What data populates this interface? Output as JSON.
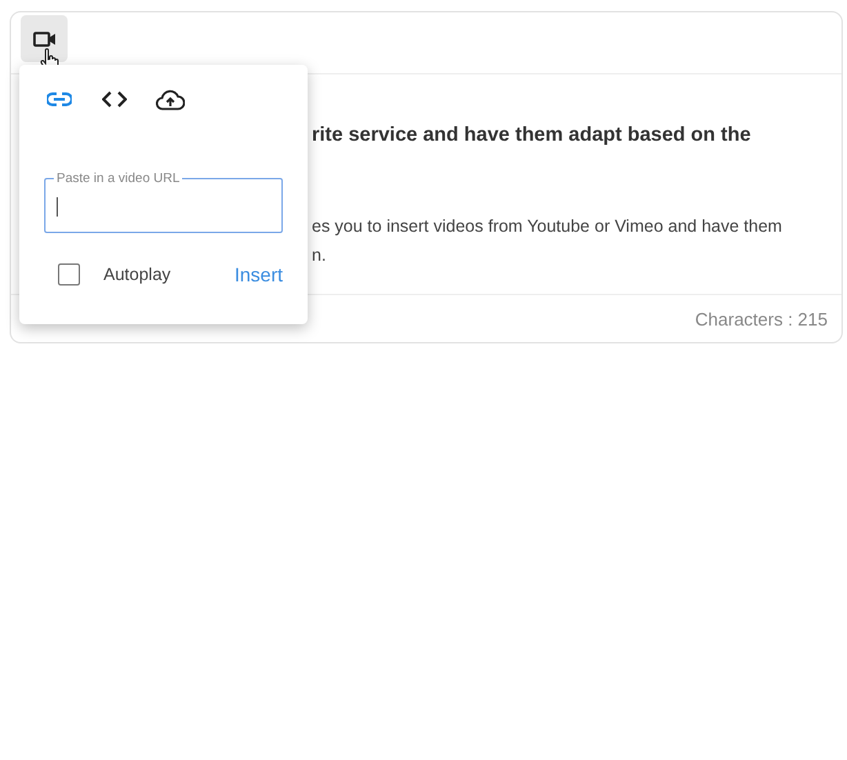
{
  "toolbar": {
    "video_button": {
      "selected": true
    }
  },
  "content": {
    "heading": "rite service and have them adapt based on the",
    "paragraph_lines": [
      "es you to insert videos from Youtube or Vimeo and have them",
      "n."
    ]
  },
  "footer": {
    "count": "Characters : 215"
  },
  "video_popup": {
    "tabs": [
      {
        "kind": "link",
        "selected": true
      },
      {
        "kind": "code",
        "selected": false
      },
      {
        "kind": "upload",
        "selected": false
      }
    ],
    "url_field": {
      "label": "Paste in a video URL"
    },
    "autoplay": {
      "label": "Autoplay",
      "checked": false
    },
    "insert_button": "Insert"
  }
}
